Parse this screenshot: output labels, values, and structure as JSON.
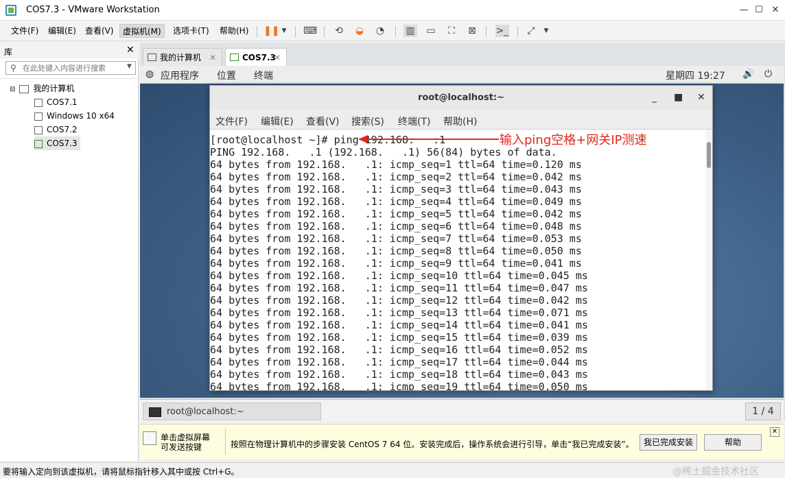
{
  "window": {
    "title": "COS7.3 - VMware Workstation"
  },
  "menubar": {
    "items": [
      "文件(F)",
      "编辑(E)",
      "查看(V)",
      "虚拟机(M)",
      "选项卡(T)",
      "帮助(H)"
    ]
  },
  "library": {
    "title": "库",
    "search_placeholder": "在此处键入内容进行搜索",
    "tree": [
      {
        "label": "我的计算机"
      },
      {
        "label": "COS7.1"
      },
      {
        "label": "Windows 10 x64"
      },
      {
        "label": "COS7.2"
      },
      {
        "label": "COS7.3"
      }
    ]
  },
  "tabs": [
    {
      "label": "我的计算机"
    },
    {
      "label": "COS7.3"
    }
  ],
  "gnome": {
    "apps": "应用程序",
    "places": "位置",
    "terminal": "终端",
    "clock": "星期四 19:27"
  },
  "terminal": {
    "title": "root@localhost:~",
    "menu": [
      "文件(F)",
      "编辑(E)",
      "查看(V)",
      "搜索(S)",
      "终端(T)",
      "帮助(H)"
    ],
    "lines": [
      "[root@localhost ~]# ping 192.168.   .1",
      "PING 192.168.   .1 (192.168.   .1) 56(84) bytes of data.",
      "64 bytes from 192.168.   .1: icmp_seq=1 ttl=64 time=0.120 ms",
      "64 bytes from 192.168.   .1: icmp_seq=2 ttl=64 time=0.042 ms",
      "64 bytes from 192.168.   .1: icmp_seq=3 ttl=64 time=0.043 ms",
      "64 bytes from 192.168.   .1: icmp_seq=4 ttl=64 time=0.049 ms",
      "64 bytes from 192.168.   .1: icmp_seq=5 ttl=64 time=0.042 ms",
      "64 bytes from 192.168.   .1: icmp_seq=6 ttl=64 time=0.048 ms",
      "64 bytes from 192.168.   .1: icmp_seq=7 ttl=64 time=0.053 ms",
      "64 bytes from 192.168.   .1: icmp_seq=8 ttl=64 time=0.050 ms",
      "64 bytes from 192.168.   .1: icmp_seq=9 ttl=64 time=0.041 ms",
      "64 bytes from 192.168.   .1: icmp_seq=10 ttl=64 time=0.045 ms",
      "64 bytes from 192.168.   .1: icmp_seq=11 ttl=64 time=0.047 ms",
      "64 bytes from 192.168.   .1: icmp_seq=12 ttl=64 time=0.042 ms",
      "64 bytes from 192.168.   .1: icmp_seq=13 ttl=64 time=0.071 ms",
      "64 bytes from 192.168.   .1: icmp_seq=14 ttl=64 time=0.041 ms",
      "64 bytes from 192.168.   .1: icmp_seq=15 ttl=64 time=0.039 ms",
      "64 bytes from 192.168.   .1: icmp_seq=16 ttl=64 time=0.052 ms",
      "64 bytes from 192.168.   .1: icmp_seq=17 ttl=64 time=0.044 ms",
      "64 bytes from 192.168.   .1: icmp_seq=18 ttl=64 time=0.043 ms",
      "64 bytes from 192.168.   .1: icmp_seq=19 ttl=64 time=0.050 ms"
    ],
    "annotation": "输入ping空格+网关IP测速"
  },
  "taskbar": {
    "item_label": "root@localhost:~",
    "workspace": "1 / 4"
  },
  "install_bar": {
    "left_text_1": "单击虚拟屏幕",
    "left_text_2": "可发送按键",
    "message": "按照在物理计算机中的步骤安装 CentOS 7 64 位。安装完成后，操作系统会进行引导，单击“我已完成安装”。",
    "done_button": "我已完成安装",
    "help_button": "帮助"
  },
  "statusbar": {
    "text": "要将输入定向到该虚拟机，请将鼠标指针移入其中或按 Ctrl+G。",
    "watermark": "@稀土掘金技术社区"
  },
  "colors": {
    "annotation": "#e0261c",
    "desktop": "#3d5f85"
  }
}
